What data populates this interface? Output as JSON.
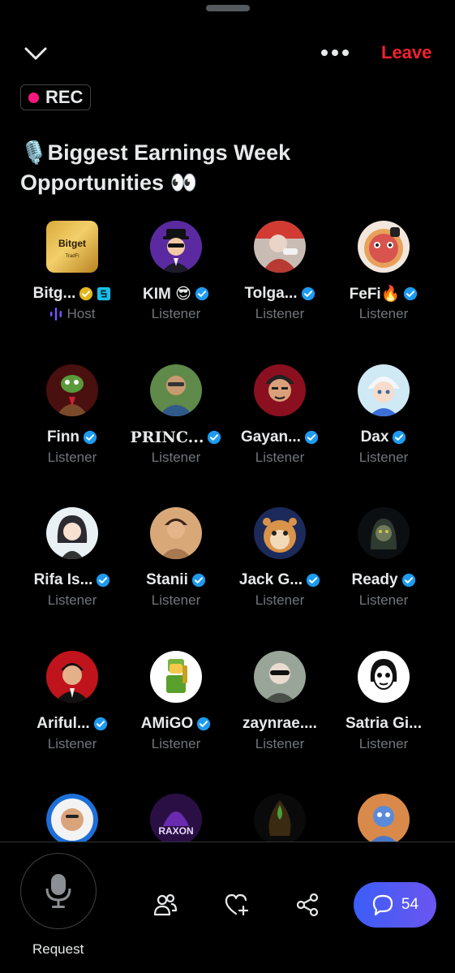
{
  "header": {
    "collapse_icon": "chevron-down-icon",
    "more_icon": "more-horizontal-icon",
    "leave_label": "Leave",
    "rec_label": "REC",
    "title_line1": "🎙️Biggest Earnings Week",
    "title_line2": "Opportunities 👀"
  },
  "participants": [
    {
      "name": "Bitg...",
      "role": "Host",
      "badge": "gold"
    },
    {
      "name": "KIM 😎",
      "role": "Listener",
      "badge": "blue"
    },
    {
      "name": "Tolga...",
      "role": "Listener",
      "badge": "blue"
    },
    {
      "name": "FeFi🔥",
      "role": "Listener",
      "badge": "blue"
    },
    {
      "name": "Finn",
      "role": "Listener",
      "badge": "blue"
    },
    {
      "name": "PRINC...",
      "role": "Listener",
      "badge": "blue"
    },
    {
      "name": "Gayan...",
      "role": "Listener",
      "badge": "blue"
    },
    {
      "name": "Dax",
      "role": "Listener",
      "badge": "blue"
    },
    {
      "name": "Rifa Is...",
      "role": "Listener",
      "badge": "blue"
    },
    {
      "name": "Stanii",
      "role": "Listener",
      "badge": "blue"
    },
    {
      "name": "Jack G...",
      "role": "Listener",
      "badge": "blue"
    },
    {
      "name": "Ready",
      "role": "Listener",
      "badge": "blue"
    },
    {
      "name": "Ariful...",
      "role": "Listener",
      "badge": "blue"
    },
    {
      "name": "AMiGO",
      "role": "Listener",
      "badge": "blue"
    },
    {
      "name": "zaynrae....",
      "role": "Listener",
      "badge": "none"
    },
    {
      "name": "Satria Gi...",
      "role": "Listener",
      "badge": "none"
    },
    {
      "name": "",
      "role": "",
      "badge": "none"
    },
    {
      "name": "",
      "role": "",
      "badge": "none"
    },
    {
      "name": "",
      "role": "",
      "badge": "none"
    },
    {
      "name": "",
      "role": "",
      "badge": "none"
    }
  ],
  "avatar_text": {
    "bitget_logo": "Bitget",
    "bitget_sub": "TradFi",
    "raxon": "RAXON"
  },
  "footer": {
    "request_label": "Request",
    "chat_count": "54",
    "icons": [
      "microphone-icon",
      "people-icon",
      "heart-plus-icon",
      "share-icon",
      "chat-bubble-icon"
    ]
  },
  "colors": {
    "background": "#000000",
    "leave": "#f4212e",
    "rec_dot": "#f91880",
    "verified": "#1d9bf0",
    "host_accent": "#7856ff",
    "chat_gradient_start": "#3b5ef7",
    "chat_gradient_end": "#6c55f0"
  }
}
